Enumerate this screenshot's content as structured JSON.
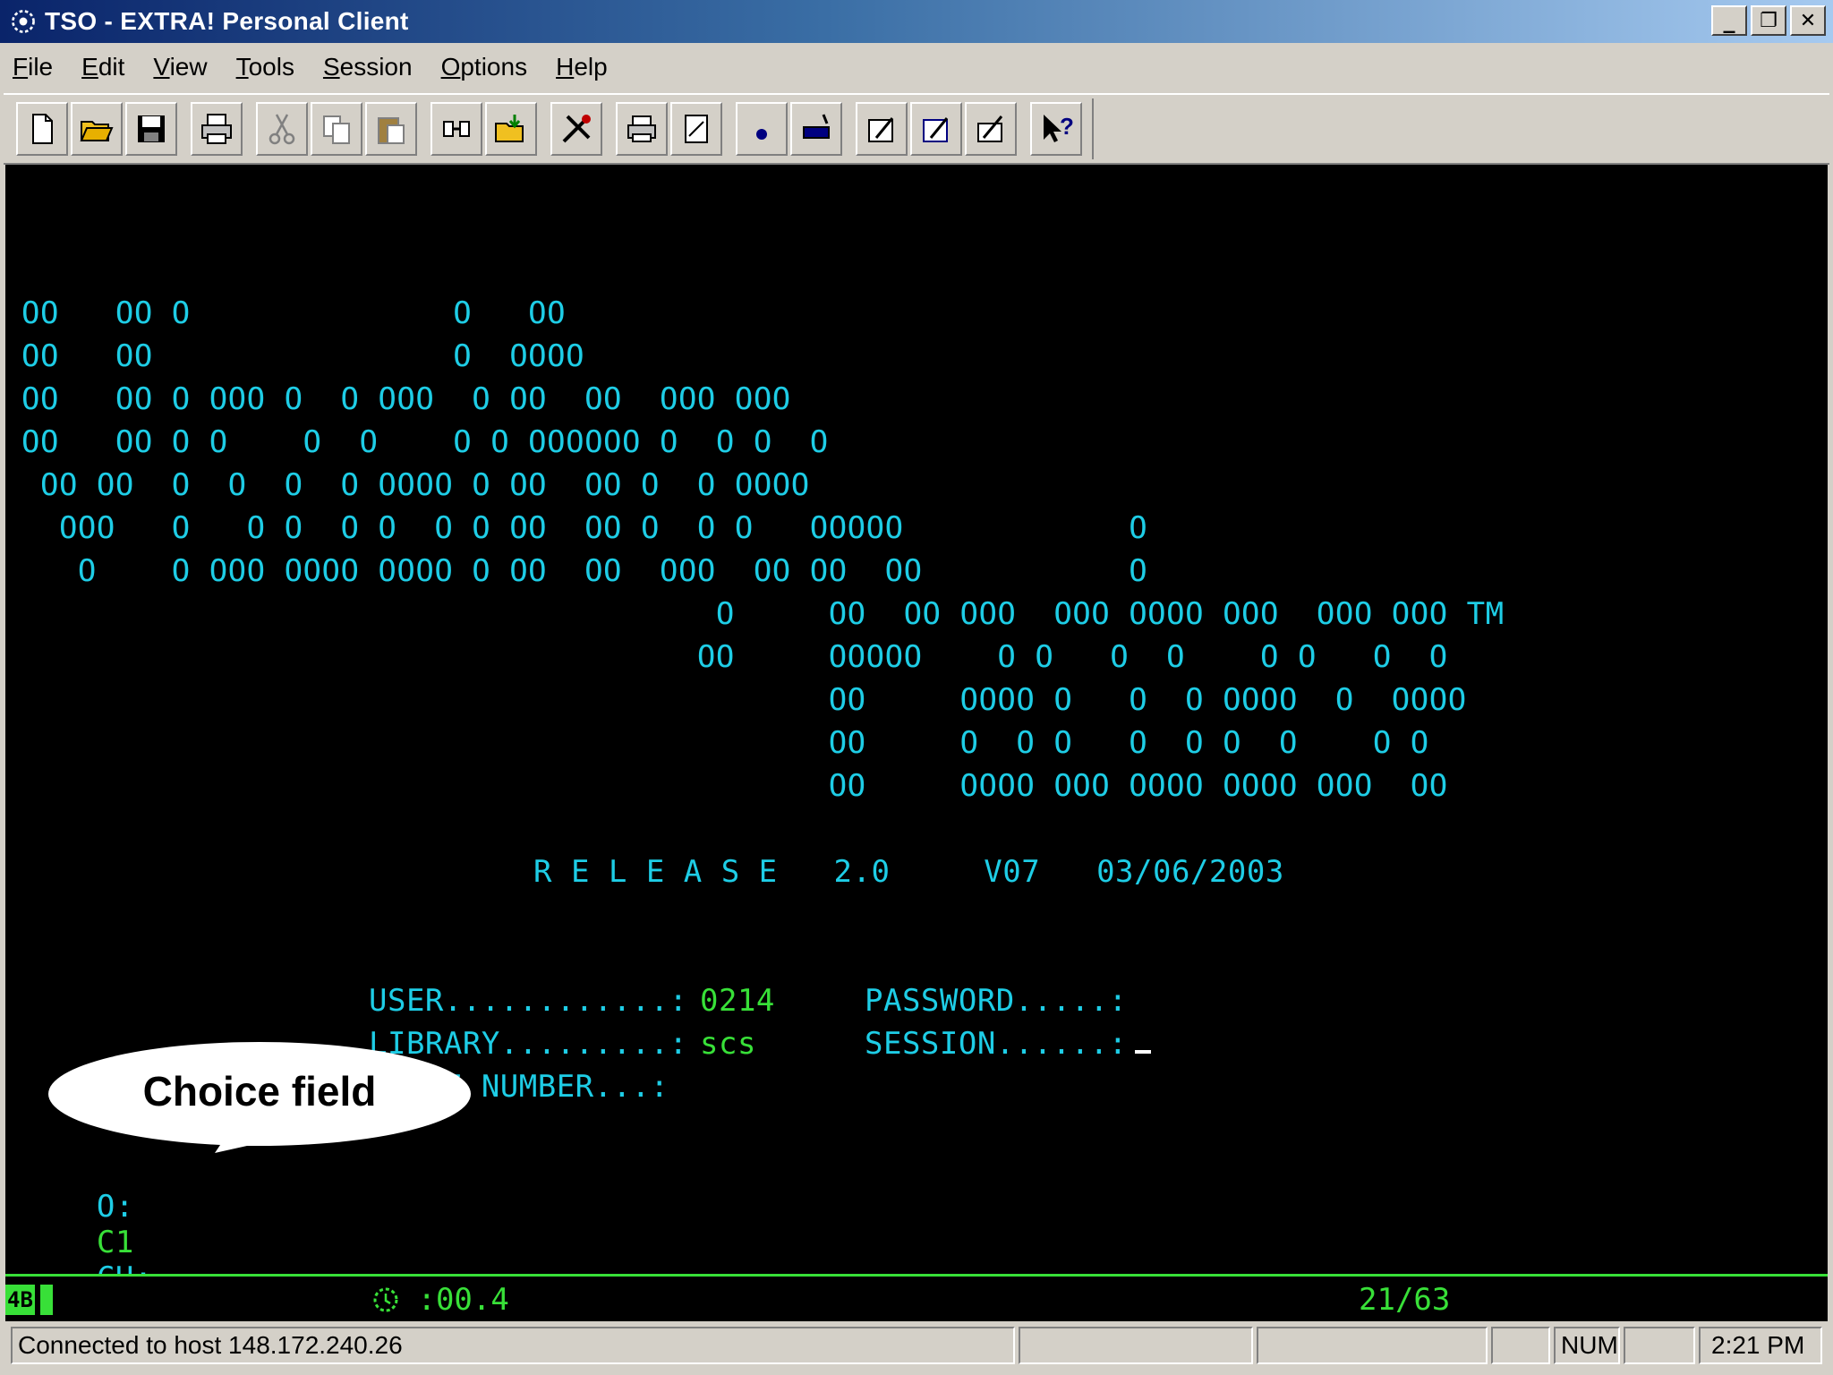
{
  "window": {
    "title": "TSO - EXTRA! Personal Client"
  },
  "window_buttons": {
    "minimize": "_",
    "restore": "❐",
    "close": "✕"
  },
  "menu": [
    {
      "label": "File",
      "accel": "F",
      "rest": "ile"
    },
    {
      "label": "Edit",
      "accel": "E",
      "rest": "dit"
    },
    {
      "label": "View",
      "accel": "V",
      "rest": "iew"
    },
    {
      "label": "Tools",
      "accel": "T",
      "rest": "ools"
    },
    {
      "label": "Session",
      "accel": "S",
      "rest": "ession"
    },
    {
      "label": "Options",
      "accel": "O",
      "rest": "ptions"
    },
    {
      "label": "Help",
      "accel": "H",
      "rest": "elp"
    }
  ],
  "toolbar_icons": [
    "new-icon",
    "open-icon",
    "save-icon",
    "print-icon",
    "cut-icon",
    "copy-icon",
    "paste-icon",
    "connect-icon",
    "transfer-icon",
    "tools-icon",
    "printer-session-icon",
    "page-setup-icon",
    "record-icon",
    "macro-icon",
    "edit-macro-icon",
    "run-macro-icon",
    "settings-icon",
    "help-icon"
  ],
  "terminal": {
    "banner": [
      "OO   OO O              O   OO",
      "OO   OO                O  OOOO",
      "OO   OO O OOO O  O OOO  O OO  OO  OOO OOO",
      "OO   OO O O    O  O    O O OOOOOO O  O O  O",
      " OO OO  O  O  O  O OOOO O OO  OO O  O OOOO",
      "  OOO   O   O O  O O  O O OO  OO O  O O   OOOOO            O",
      "   O    O OOO OOOO OOOO O OO  OO  OOO  OO OO  OO           O",
      "                                     O     OO  OO OOO  OOO OOOO OOO  OOO OOO TM",
      "                                    OO     OOOOO    O O   O  O    O O   O  O",
      "                                           OO     OOOO O   O  O OOOO  O  OOOO",
      "                                           OO     O  O O   O  O O  O    O O",
      "                                           OO     OOOO OOO OOOO OOOO OOO  OO"
    ],
    "release": "R E L E A S E   2.0     V07   03/06/2003",
    "user_label": "USER............: ",
    "user_value": "0214",
    "password_label": "PASSWORD.....:",
    "library_label": "LIBRARY.........: ",
    "library_value": "scs",
    "session_label": "SESSION......:",
    "phone_label": "PHONE NUMBER...:",
    "choice_label": "O:",
    "choice_value": "C1",
    "choice_suffix": "CH:"
  },
  "callout": {
    "text": "Choice field"
  },
  "oia": {
    "badge": "4B",
    "timer": ":00.4",
    "cursor_pos": "21/63"
  },
  "status": {
    "message": "Connected to host 148.172.240.26",
    "num": "NUM",
    "time": "2:21 PM"
  }
}
